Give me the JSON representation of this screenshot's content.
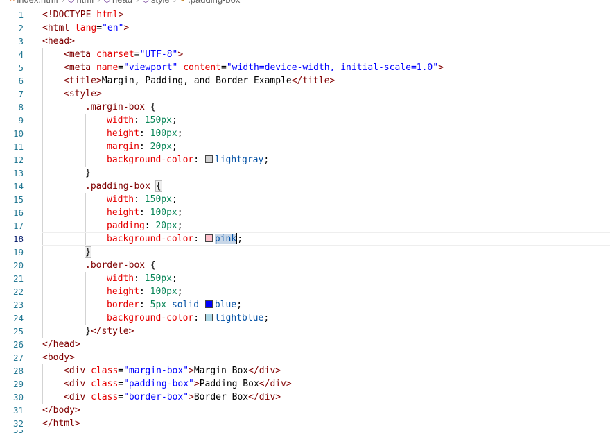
{
  "breadcrumb": {
    "items": [
      {
        "icon": "html-file-icon",
        "label": "index.html"
      },
      {
        "icon": "element-icon",
        "label": "html"
      },
      {
        "icon": "element-icon",
        "label": "head"
      },
      {
        "icon": "element-icon",
        "label": "style"
      },
      {
        "icon": "css-selector-icon",
        "label": ".padding-box"
      }
    ],
    "separator": "›"
  },
  "editor": {
    "active_line": 18,
    "colors": {
      "lightgray": "#d3d3d3",
      "pink": "#ffc0cb",
      "blue": "#0000ff",
      "lightblue": "#add8e6"
    },
    "lines": [
      {
        "n": "1",
        "indent": 0,
        "tokens": [
          [
            "t-punc",
            "<!"
          ],
          [
            "t-tag",
            "DOCTYPE"
          ],
          [
            "t-plain",
            " "
          ],
          [
            "t-attr",
            "html"
          ],
          [
            "t-punc",
            ">"
          ]
        ]
      },
      {
        "n": "2",
        "indent": 0,
        "tokens": [
          [
            "t-punc",
            "<"
          ],
          [
            "t-tag",
            "html"
          ],
          [
            "t-plain",
            " "
          ],
          [
            "t-attr",
            "lang"
          ],
          [
            "t-plain",
            "="
          ],
          [
            "t-val",
            "\"en\""
          ],
          [
            "t-punc",
            ">"
          ]
        ]
      },
      {
        "n": "3",
        "indent": 0,
        "tokens": [
          [
            "t-punc",
            "<"
          ],
          [
            "t-tag",
            "head"
          ],
          [
            "t-punc",
            ">"
          ]
        ]
      },
      {
        "n": "4",
        "indent": 1,
        "tokens": [
          [
            "t-punc",
            "<"
          ],
          [
            "t-tag",
            "meta"
          ],
          [
            "t-plain",
            " "
          ],
          [
            "t-attr",
            "charset"
          ],
          [
            "t-plain",
            "="
          ],
          [
            "t-val",
            "\"UTF-8\""
          ],
          [
            "t-punc",
            ">"
          ]
        ]
      },
      {
        "n": "5",
        "indent": 1,
        "tokens": [
          [
            "t-punc",
            "<"
          ],
          [
            "t-tag",
            "meta"
          ],
          [
            "t-plain",
            " "
          ],
          [
            "t-attr",
            "name"
          ],
          [
            "t-plain",
            "="
          ],
          [
            "t-val",
            "\"viewport\""
          ],
          [
            "t-plain",
            " "
          ],
          [
            "t-attr",
            "content"
          ],
          [
            "t-plain",
            "="
          ],
          [
            "t-val",
            "\"width=device-width, initial-scale=1.0\""
          ],
          [
            "t-punc",
            ">"
          ]
        ]
      },
      {
        "n": "6",
        "indent": 1,
        "tokens": [
          [
            "t-punc",
            "<"
          ],
          [
            "t-tag",
            "title"
          ],
          [
            "t-punc",
            ">"
          ],
          [
            "t-text",
            "Margin, Padding, and Border Example"
          ],
          [
            "t-punc",
            "</"
          ],
          [
            "t-tag",
            "title"
          ],
          [
            "t-punc",
            ">"
          ]
        ]
      },
      {
        "n": "7",
        "indent": 1,
        "tokens": [
          [
            "t-punc",
            "<"
          ],
          [
            "t-tag",
            "style"
          ],
          [
            "t-punc",
            ">"
          ]
        ]
      },
      {
        "n": "8",
        "indent": 2,
        "tokens": [
          [
            "t-sel",
            ".margin-box"
          ],
          [
            "t-plain",
            " "
          ],
          [
            "t-brace",
            "{"
          ]
        ]
      },
      {
        "n": "9",
        "indent": 3,
        "tokens": [
          [
            "t-prop",
            "width"
          ],
          [
            "t-plain",
            ": "
          ],
          [
            "t-num",
            "150px"
          ],
          [
            "t-plain",
            ";"
          ]
        ]
      },
      {
        "n": "10",
        "indent": 3,
        "tokens": [
          [
            "t-prop",
            "height"
          ],
          [
            "t-plain",
            ": "
          ],
          [
            "t-num",
            "100px"
          ],
          [
            "t-plain",
            ";"
          ]
        ]
      },
      {
        "n": "11",
        "indent": 3,
        "tokens": [
          [
            "t-prop",
            "margin"
          ],
          [
            "t-plain",
            ": "
          ],
          [
            "t-num",
            "20px"
          ],
          [
            "t-plain",
            ";"
          ]
        ]
      },
      {
        "n": "12",
        "indent": 3,
        "tokens": [
          [
            "t-prop",
            "background-color"
          ],
          [
            "t-plain",
            ": "
          ],
          [
            "swatch",
            "lightgray"
          ],
          [
            "t-kw",
            "lightgray"
          ],
          [
            "t-plain",
            ";"
          ]
        ]
      },
      {
        "n": "13",
        "indent": 2,
        "tokens": [
          [
            "t-brace",
            "}"
          ]
        ]
      },
      {
        "n": "14",
        "indent": 2,
        "tokens": [
          [
            "t-sel",
            ".padding-box"
          ],
          [
            "t-plain",
            " "
          ],
          [
            "t-brace match",
            "{"
          ]
        ]
      },
      {
        "n": "15",
        "indent": 3,
        "tokens": [
          [
            "t-prop",
            "width"
          ],
          [
            "t-plain",
            ": "
          ],
          [
            "t-num",
            "150px"
          ],
          [
            "t-plain",
            ";"
          ]
        ]
      },
      {
        "n": "16",
        "indent": 3,
        "tokens": [
          [
            "t-prop",
            "height"
          ],
          [
            "t-plain",
            ": "
          ],
          [
            "t-num",
            "100px"
          ],
          [
            "t-plain",
            ";"
          ]
        ]
      },
      {
        "n": "17",
        "indent": 3,
        "tokens": [
          [
            "t-prop",
            "padding"
          ],
          [
            "t-plain",
            ": "
          ],
          [
            "t-num",
            "20px"
          ],
          [
            "t-plain",
            ";"
          ]
        ]
      },
      {
        "n": "18",
        "indent": 3,
        "tokens": [
          [
            "t-prop",
            "background-color"
          ],
          [
            "t-plain",
            ": "
          ],
          [
            "swatch",
            "pink"
          ],
          [
            "t-kw wordhl",
            "pink"
          ],
          [
            "cursor",
            ""
          ],
          [
            "t-plain",
            ";"
          ]
        ]
      },
      {
        "n": "19",
        "indent": 2,
        "tokens": [
          [
            "t-brace match",
            "}"
          ]
        ]
      },
      {
        "n": "20",
        "indent": 2,
        "tokens": [
          [
            "t-sel",
            ".border-box"
          ],
          [
            "t-plain",
            " "
          ],
          [
            "t-brace",
            "{"
          ]
        ]
      },
      {
        "n": "21",
        "indent": 3,
        "tokens": [
          [
            "t-prop",
            "width"
          ],
          [
            "t-plain",
            ": "
          ],
          [
            "t-num",
            "150px"
          ],
          [
            "t-plain",
            ";"
          ]
        ]
      },
      {
        "n": "22",
        "indent": 3,
        "tokens": [
          [
            "t-prop",
            "height"
          ],
          [
            "t-plain",
            ": "
          ],
          [
            "t-num",
            "100px"
          ],
          [
            "t-plain",
            ";"
          ]
        ]
      },
      {
        "n": "23",
        "indent": 3,
        "tokens": [
          [
            "t-prop",
            "border"
          ],
          [
            "t-plain",
            ": "
          ],
          [
            "t-num",
            "5px"
          ],
          [
            "t-plain",
            " "
          ],
          [
            "t-kw",
            "solid"
          ],
          [
            "t-plain",
            " "
          ],
          [
            "swatch",
            "blue"
          ],
          [
            "t-kw",
            "blue"
          ],
          [
            "t-plain",
            ";"
          ]
        ]
      },
      {
        "n": "24",
        "indent": 3,
        "tokens": [
          [
            "t-prop",
            "background-color"
          ],
          [
            "t-plain",
            ": "
          ],
          [
            "swatch",
            "lightblue"
          ],
          [
            "t-kw",
            "lightblue"
          ],
          [
            "t-plain",
            ";"
          ]
        ]
      },
      {
        "n": "25",
        "indent": 2,
        "tokens": [
          [
            "t-brace",
            "}"
          ],
          [
            "t-punc",
            "</"
          ],
          [
            "t-tag",
            "style"
          ],
          [
            "t-punc",
            ">"
          ]
        ]
      },
      {
        "n": "26",
        "indent": 0,
        "tokens": [
          [
            "t-punc",
            "</"
          ],
          [
            "t-tag",
            "head"
          ],
          [
            "t-punc",
            ">"
          ]
        ]
      },
      {
        "n": "27",
        "indent": 0,
        "tokens": [
          [
            "t-punc",
            "<"
          ],
          [
            "t-tag",
            "body"
          ],
          [
            "t-punc",
            ">"
          ]
        ]
      },
      {
        "n": "28",
        "indent": 1,
        "tokens": [
          [
            "t-punc",
            "<"
          ],
          [
            "t-tag",
            "div"
          ],
          [
            "t-plain",
            " "
          ],
          [
            "t-attr",
            "class"
          ],
          [
            "t-plain",
            "="
          ],
          [
            "t-val",
            "\"margin-box\""
          ],
          [
            "t-punc",
            ">"
          ],
          [
            "t-text",
            "Margin Box"
          ],
          [
            "t-punc",
            "</"
          ],
          [
            "t-tag",
            "div"
          ],
          [
            "t-punc",
            ">"
          ]
        ]
      },
      {
        "n": "29",
        "indent": 1,
        "tokens": [
          [
            "t-punc",
            "<"
          ],
          [
            "t-tag",
            "div"
          ],
          [
            "t-plain",
            " "
          ],
          [
            "t-attr",
            "class"
          ],
          [
            "t-plain",
            "="
          ],
          [
            "t-val",
            "\"padding-box\""
          ],
          [
            "t-punc",
            ">"
          ],
          [
            "t-text",
            "Padding Box"
          ],
          [
            "t-punc",
            "</"
          ],
          [
            "t-tag",
            "div"
          ],
          [
            "t-punc",
            ">"
          ]
        ]
      },
      {
        "n": "30",
        "indent": 1,
        "tokens": [
          [
            "t-punc",
            "<"
          ],
          [
            "t-tag",
            "div"
          ],
          [
            "t-plain",
            " "
          ],
          [
            "t-attr",
            "class"
          ],
          [
            "t-plain",
            "="
          ],
          [
            "t-val",
            "\"border-box\""
          ],
          [
            "t-punc",
            ">"
          ],
          [
            "t-text",
            "Border Box"
          ],
          [
            "t-punc",
            "</"
          ],
          [
            "t-tag",
            "div"
          ],
          [
            "t-punc",
            ">"
          ]
        ]
      },
      {
        "n": "31",
        "indent": 0,
        "tokens": [
          [
            "t-punc",
            "</"
          ],
          [
            "t-tag",
            "body"
          ],
          [
            "t-punc",
            ">"
          ]
        ]
      },
      {
        "n": "32",
        "indent": 0,
        "tokens": [
          [
            "t-punc",
            "</"
          ],
          [
            "t-tag",
            "html"
          ],
          [
            "t-punc",
            ">"
          ]
        ]
      }
    ]
  }
}
